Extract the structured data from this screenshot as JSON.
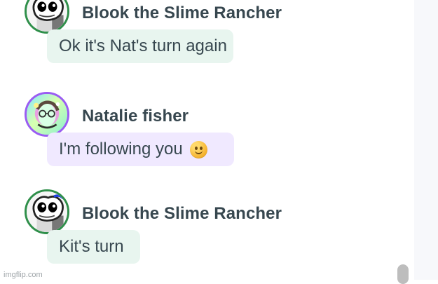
{
  "messages": [
    {
      "sender": "Blook the Slime Rancher",
      "text": "Ok it's Nat's turn again",
      "avatar_icon": "blook-avatar-icon",
      "bubble_color": "#e8f5ef"
    },
    {
      "sender": "Natalie fisher",
      "text": "I'm following you",
      "emoji": "slightly-smiling-face-icon",
      "avatar_icon": "natalie-avatar-icon",
      "bubble_color": "#f0e9ff"
    },
    {
      "sender": "Blook the Slime Rancher",
      "text": "Kit's turn",
      "avatar_icon": "blook-avatar-icon",
      "bubble_color": "#e8f5ef"
    }
  ],
  "watermark": "imgflip.com",
  "colors": {
    "text": "#37474f",
    "green_ring": "#2f8f4a",
    "purple_ring": "#9a5cf2",
    "sidebar": "#f7f8fb",
    "scrollbar": "#bdbdbd"
  }
}
